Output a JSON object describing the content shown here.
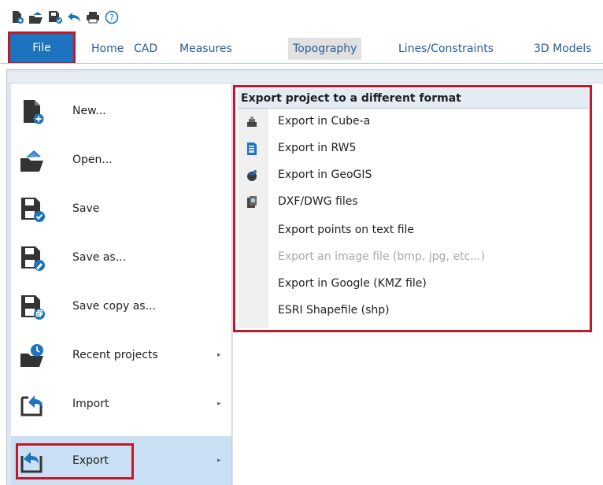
{
  "quick_access": {
    "icons": [
      "new-document-icon",
      "open-folder-icon",
      "save-icon",
      "undo-icon",
      "print-icon",
      "help-icon"
    ],
    "help_glyph": "?"
  },
  "tabs": {
    "file": "File",
    "items": [
      "Home",
      "CAD",
      "Measures",
      "Topography",
      "Lines/Constraints",
      "3D Models"
    ],
    "active_index": 3
  },
  "menu": {
    "items": [
      {
        "label": "New...",
        "icon": "new-document-icon",
        "has_submenu": false
      },
      {
        "label": "Open...",
        "icon": "open-folder-icon",
        "has_submenu": false
      },
      {
        "label": "Save",
        "icon": "save-icon",
        "has_submenu": false
      },
      {
        "label": "Save as...",
        "icon": "save-as-icon",
        "has_submenu": false
      },
      {
        "label": "Save copy as...",
        "icon": "save-copy-icon",
        "has_submenu": false
      },
      {
        "label": "Recent projects",
        "icon": "recent-projects-icon",
        "has_submenu": true
      },
      {
        "label": "Import",
        "icon": "import-icon",
        "has_submenu": true
      },
      {
        "label": "Export",
        "icon": "export-icon",
        "has_submenu": true
      }
    ],
    "selected": "Export",
    "arrow": "▸"
  },
  "submenu": {
    "header": "Export project to a different format",
    "items": [
      {
        "label": "Export in Cube-a",
        "icon": "cube-a-icon",
        "enabled": true
      },
      {
        "label": "Export in RW5",
        "icon": "rw5-file-icon",
        "enabled": true
      },
      {
        "label": "Export in GeoGIS",
        "icon": "geogis-icon",
        "enabled": true
      },
      {
        "label": "DXF/DWG files",
        "icon": "dxf-dwg-icon",
        "enabled": true
      },
      {
        "label": "Export points on text file",
        "icon": "",
        "enabled": true
      },
      {
        "label": "Export an image file (bmp, jpg, etc...)",
        "icon": "",
        "enabled": false
      },
      {
        "label": "Export in Google (KMZ file)",
        "icon": "",
        "enabled": true
      },
      {
        "label": "ESRI Shapefile (shp)",
        "icon": "",
        "enabled": true
      }
    ]
  },
  "colors": {
    "accent_blue": "#1e73be",
    "tab_text": "#2a5a96",
    "highlight_red": "#c0192c",
    "selected_bg": "#c9dff3",
    "disabled_text": "#a8a8a8"
  }
}
